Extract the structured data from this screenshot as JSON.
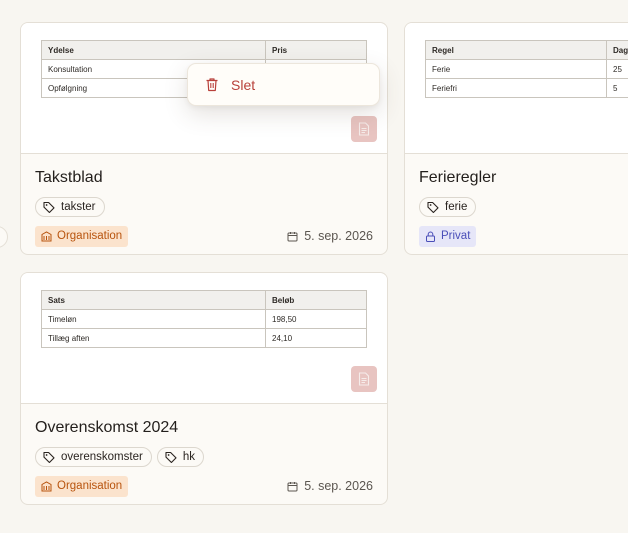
{
  "cards": [
    {
      "title": "Takstblad",
      "preview": {
        "headers": [
          "Ydelse",
          "Pris"
        ],
        "rows": [
          [
            "Konsultation",
            ""
          ],
          [
            "Opfølgning",
            ""
          ]
        ]
      },
      "tags": [
        "takster"
      ],
      "visibility": "Organisation",
      "date": "5. sep. 2026"
    },
    {
      "title": "Ferieregler",
      "preview": {
        "headers": [
          "Regel",
          "Dage"
        ],
        "rows": [
          [
            "Ferie",
            "25"
          ],
          [
            "Feriefri",
            "5"
          ]
        ]
      },
      "tags": [
        "ferie"
      ],
      "visibility": "Privat",
      "date": ""
    },
    {
      "title": "Overenskomst 2024",
      "preview": {
        "headers": [
          "Sats",
          "Beløb"
        ],
        "rows": [
          [
            "Timeløn",
            "198,50"
          ],
          [
            "Tillæg aften",
            "24,10"
          ]
        ]
      },
      "tags": [
        "overenskomster",
        "hk"
      ],
      "visibility": "Organisation",
      "date": "5. sep. 2026"
    }
  ],
  "context_menu": {
    "delete_label": "Slet"
  },
  "icons": {
    "tag": "tag-icon",
    "calendar": "calendar-icon",
    "organisation": "building-icon",
    "private": "lock-icon",
    "document": "document-icon",
    "delete": "trash-icon"
  },
  "colors": {
    "background": "#f8f6f1",
    "org_badge_bg": "#fbe3cd",
    "org_badge_text": "#b8540e",
    "private_badge_bg": "#e6e6f8",
    "private_badge_text": "#4a4eb8",
    "danger": "#b8403a"
  }
}
